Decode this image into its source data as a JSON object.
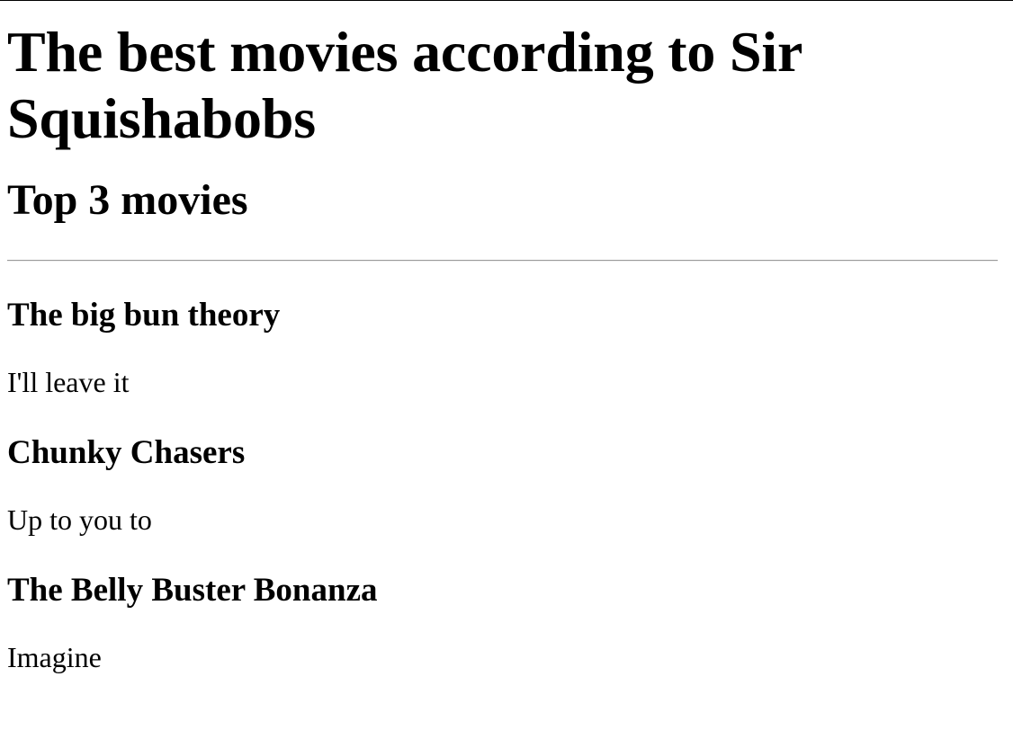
{
  "page": {
    "title": "The best movies according to Sir Squishabobs",
    "subtitle": "Top 3 movies"
  },
  "movies": [
    {
      "title": "The big bun theory",
      "description": "I'll leave it"
    },
    {
      "title": "Chunky Chasers",
      "description": "Up to you to"
    },
    {
      "title": "The Belly Buster Bonanza",
      "description": "Imagine"
    }
  ],
  "colors": {
    "background": "#ffffff",
    "text": "#000000",
    "divider": "#9a9a9a"
  }
}
